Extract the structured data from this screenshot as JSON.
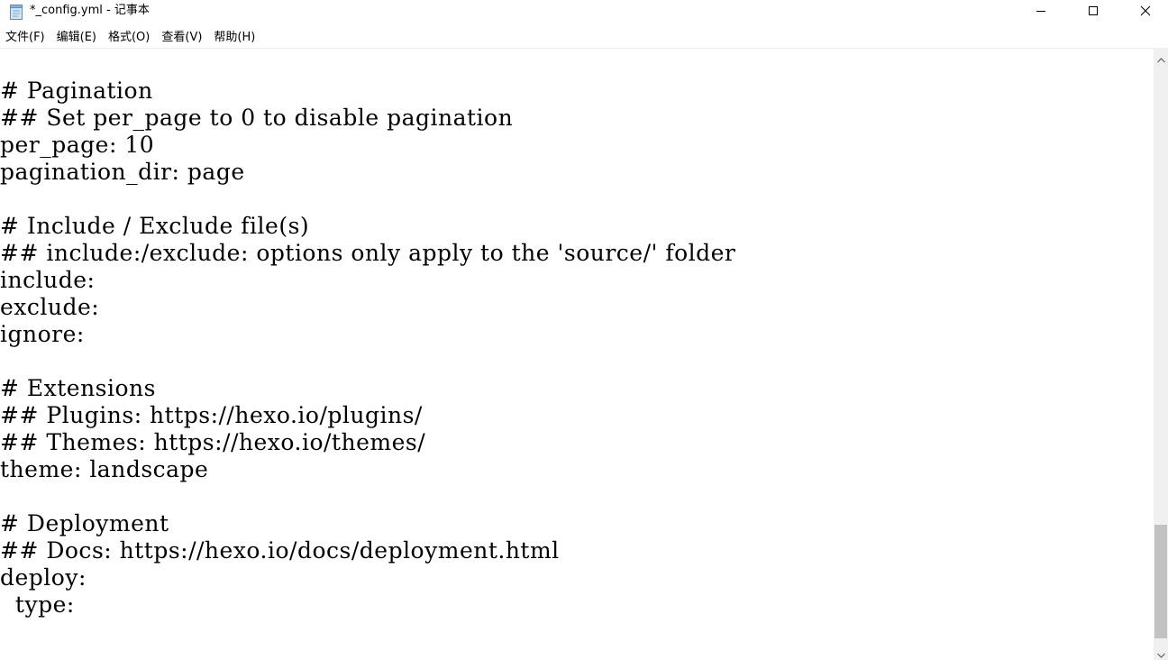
{
  "window": {
    "title": "*_config.yml - 记事本",
    "app_icon": "notepad-icon",
    "controls": {
      "minimize_icon": "minimize-icon",
      "maximize_icon": "maximize-icon",
      "close_icon": "close-icon"
    }
  },
  "menu": {
    "items": [
      {
        "label": "文件(F)"
      },
      {
        "label": "编辑(E)"
      },
      {
        "label": "格式(O)"
      },
      {
        "label": "查看(V)"
      },
      {
        "label": "帮助(H)"
      }
    ]
  },
  "editor": {
    "lines": [
      "# Pagination",
      "## Set per_page to 0 to disable pagination",
      "per_page: 10",
      "pagination_dir: page",
      "",
      "# Include / Exclude file(s)",
      "## include:/exclude: options only apply to the 'source/' folder",
      "include:",
      "exclude:",
      "ignore:",
      "",
      "# Extensions",
      "## Plugins: https://hexo.io/plugins/",
      "## Themes: https://hexo.io/themes/",
      "theme: landscape",
      "",
      "# Deployment",
      "## Docs: https://hexo.io/docs/deployment.html",
      "deploy:",
      "  type:"
    ]
  },
  "scrollbar": {
    "up_icon": "scroll-up-arrow-icon",
    "down_icon": "scroll-down-arrow-icon",
    "position_fraction": 1.0
  }
}
